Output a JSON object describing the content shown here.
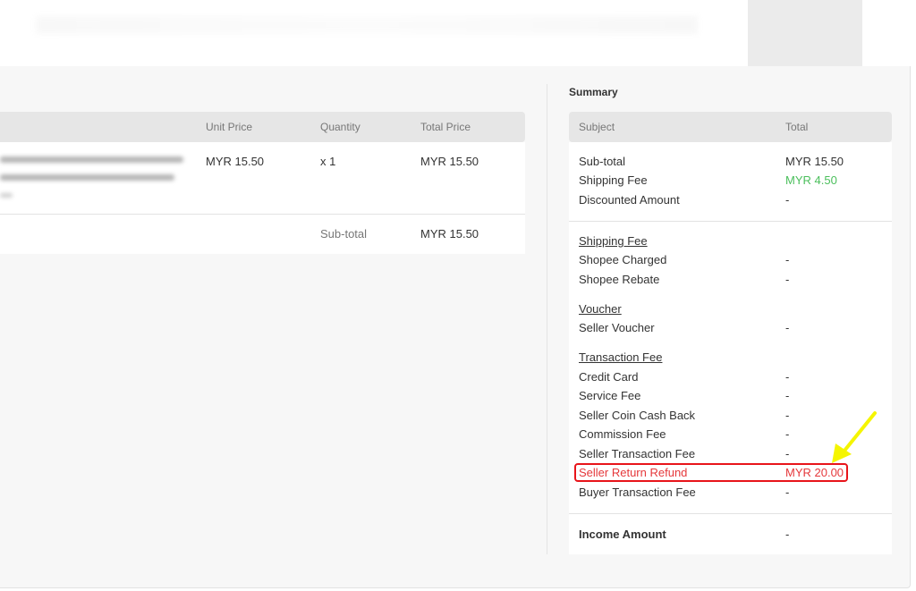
{
  "order": {
    "headers": {
      "unit_price": "Unit Price",
      "quantity": "Quantity",
      "total_price": "Total Price"
    },
    "item": {
      "unit_price": "MYR 15.50",
      "quantity": "x 1",
      "total_price": "MYR 15.50"
    },
    "subtotal_label": "Sub-total",
    "subtotal_value": "MYR 15.50"
  },
  "summary": {
    "title": "Summary",
    "headers": {
      "subject": "Subject",
      "total": "Total"
    },
    "top_rows": [
      {
        "label": "Sub-total",
        "value": "MYR 15.50"
      },
      {
        "label": "Shipping Fee",
        "value": "MYR 4.50"
      },
      {
        "label": "Discounted Amount",
        "value": "-"
      }
    ],
    "shipping_fee": {
      "title": "Shipping Fee",
      "rows": [
        {
          "label": "Shopee Charged",
          "value": "-"
        },
        {
          "label": "Shopee Rebate",
          "value": "-"
        }
      ]
    },
    "voucher": {
      "title": "Voucher",
      "rows": [
        {
          "label": "Seller Voucher",
          "value": "-"
        }
      ]
    },
    "transaction_fee": {
      "title": "Transaction Fee",
      "rows": [
        {
          "label": "Credit Card",
          "value": "-"
        },
        {
          "label": "Service Fee",
          "value": "-"
        },
        {
          "label": "Seller Coin Cash Back",
          "value": "-"
        },
        {
          "label": "Commission Fee",
          "value": "-"
        },
        {
          "label": "Seller Transaction Fee",
          "value": "-"
        },
        {
          "label": "Seller Return Refund",
          "value": "MYR 20.00"
        },
        {
          "label": "Buyer Transaction Fee",
          "value": "-"
        }
      ]
    },
    "income": {
      "label": "Income Amount",
      "value": "-"
    }
  },
  "colors": {
    "positive": "#4bbf5c",
    "refund": "#e5383b",
    "annotation_box": "#e8141a",
    "annotation_arrow": "#f5f500"
  },
  "icons": {
    "annotation": "yellow-arrow-icon"
  }
}
